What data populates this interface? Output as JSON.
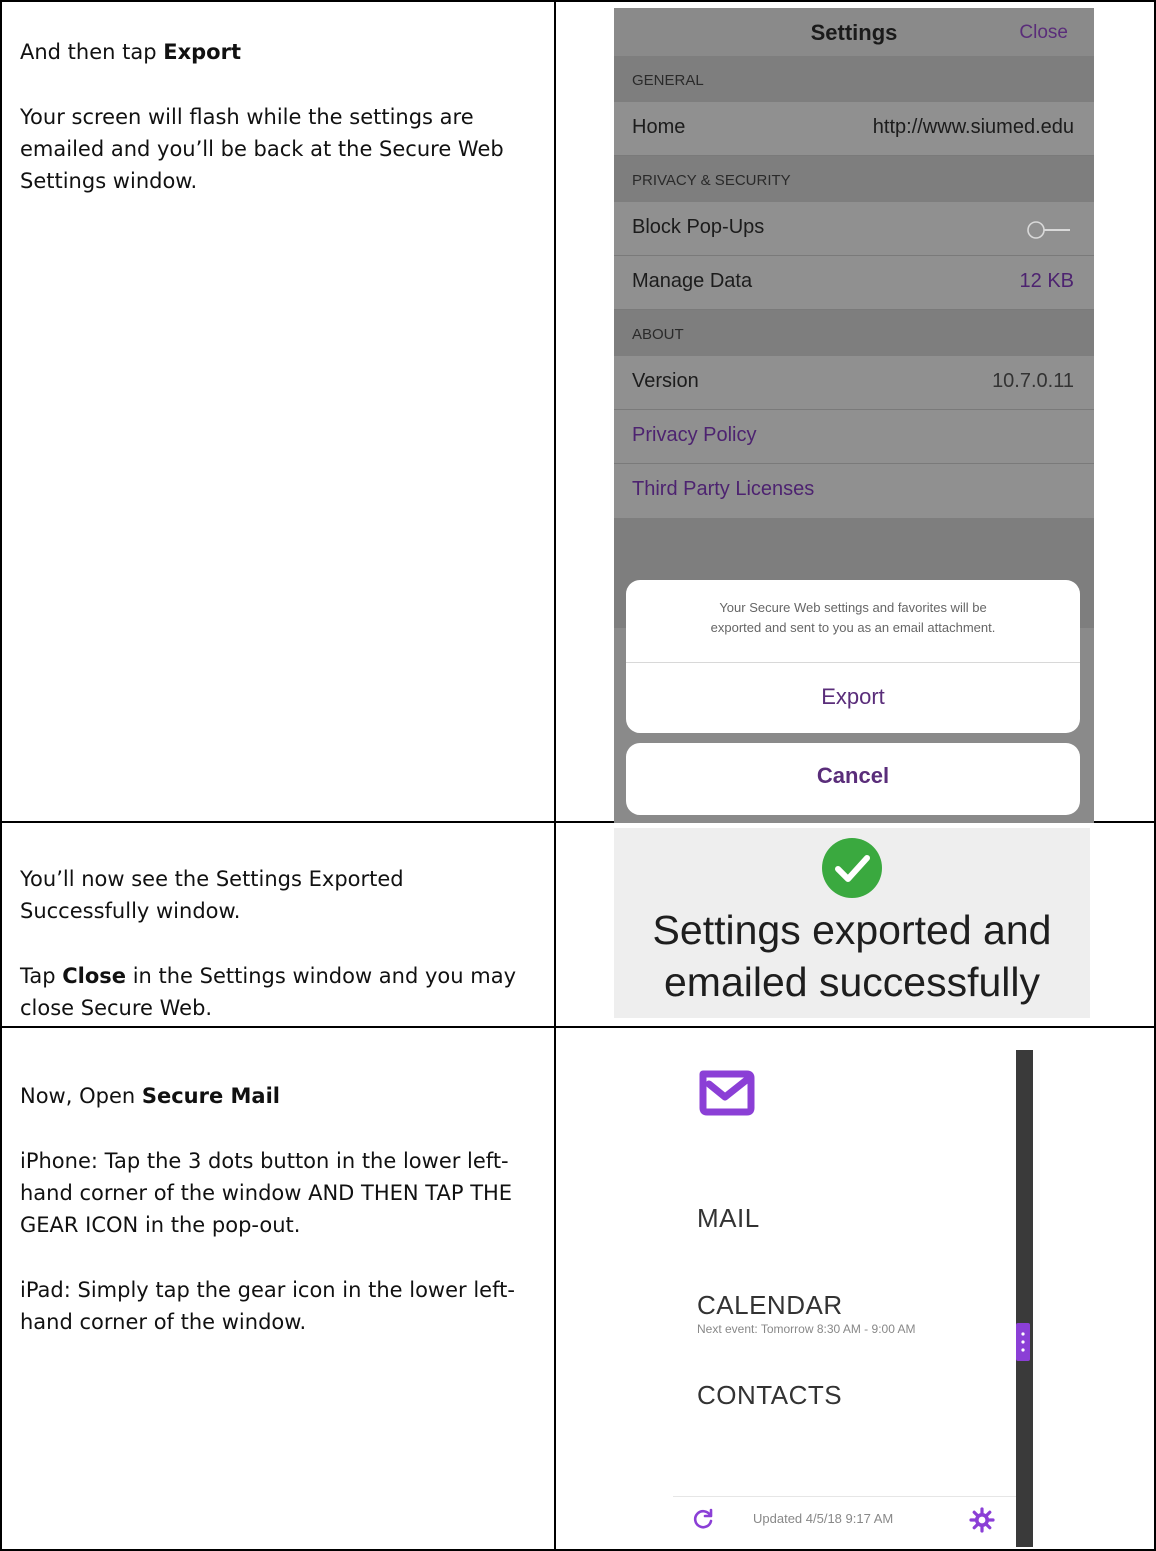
{
  "rows": [
    {
      "paragraphs": [
        {
          "pre": "And then tap ",
          "bold": "Export",
          "post": ""
        },
        {
          "pre": "Your screen will flash while the settings are emailed and you’ll be back at the Secure Web Settings window.",
          "bold": "",
          "post": ""
        }
      ]
    },
    {
      "paragraphs": [
        {
          "pre": "You’ll now see the Settings Exported Successfully window.",
          "bold": "",
          "post": ""
        },
        {
          "pre": "Tap ",
          "bold": "Close",
          "post": " in the Settings window and you may close Secure Web."
        }
      ]
    },
    {
      "paragraphs": [
        {
          "pre": "Now, Open ",
          "bold": "Secure Mail",
          "post": ""
        },
        {
          "pre": "iPhone: Tap the 3 dots button in the lower left-hand corner of the window AND THEN TAP THE GEAR ICON in the pop-out.",
          "bold": "",
          "post": ""
        },
        {
          "pre": "iPad: Simply tap the gear icon in the lower left-hand corner of the window.",
          "bold": "",
          "post": ""
        }
      ]
    }
  ],
  "settings_screen": {
    "title": "Settings",
    "close_label": "Close",
    "sections": {
      "general": "GENERAL",
      "privacy": "PRIVACY & SECURITY",
      "about": "ABOUT"
    },
    "home_label": "Home",
    "home_value": "http://www.siumed.edu",
    "block_popups_label": "Block Pop-Ups",
    "block_popups_enabled": false,
    "manage_data_label": "Manage Data",
    "manage_data_value": "12 KB",
    "version_label": "Version",
    "version_value": "10.7.0.11",
    "privacy_policy": "Privacy Policy",
    "third_party": "Third Party Licenses",
    "sheet_message_line1": "Your Secure Web settings and favorites will be",
    "sheet_message_line2": "exported and sent to you as an email attachment.",
    "export_label": "Export",
    "cancel_label": "Cancel",
    "accent_color": "#5a2d7a"
  },
  "exported_panel": {
    "line1": "Settings exported and",
    "line2": "emailed successfully",
    "check_color": "#3aa93f"
  },
  "mail_screen": {
    "menu": [
      "MAIL",
      "CALENDAR",
      "CONTACTS"
    ],
    "calendar_next_event": "Next event: Tomorrow 8:30 AM - 9:00 AM",
    "updated_text": "Updated 4/5/18 9:17 AM",
    "accent_color": "#8b3fd6"
  }
}
